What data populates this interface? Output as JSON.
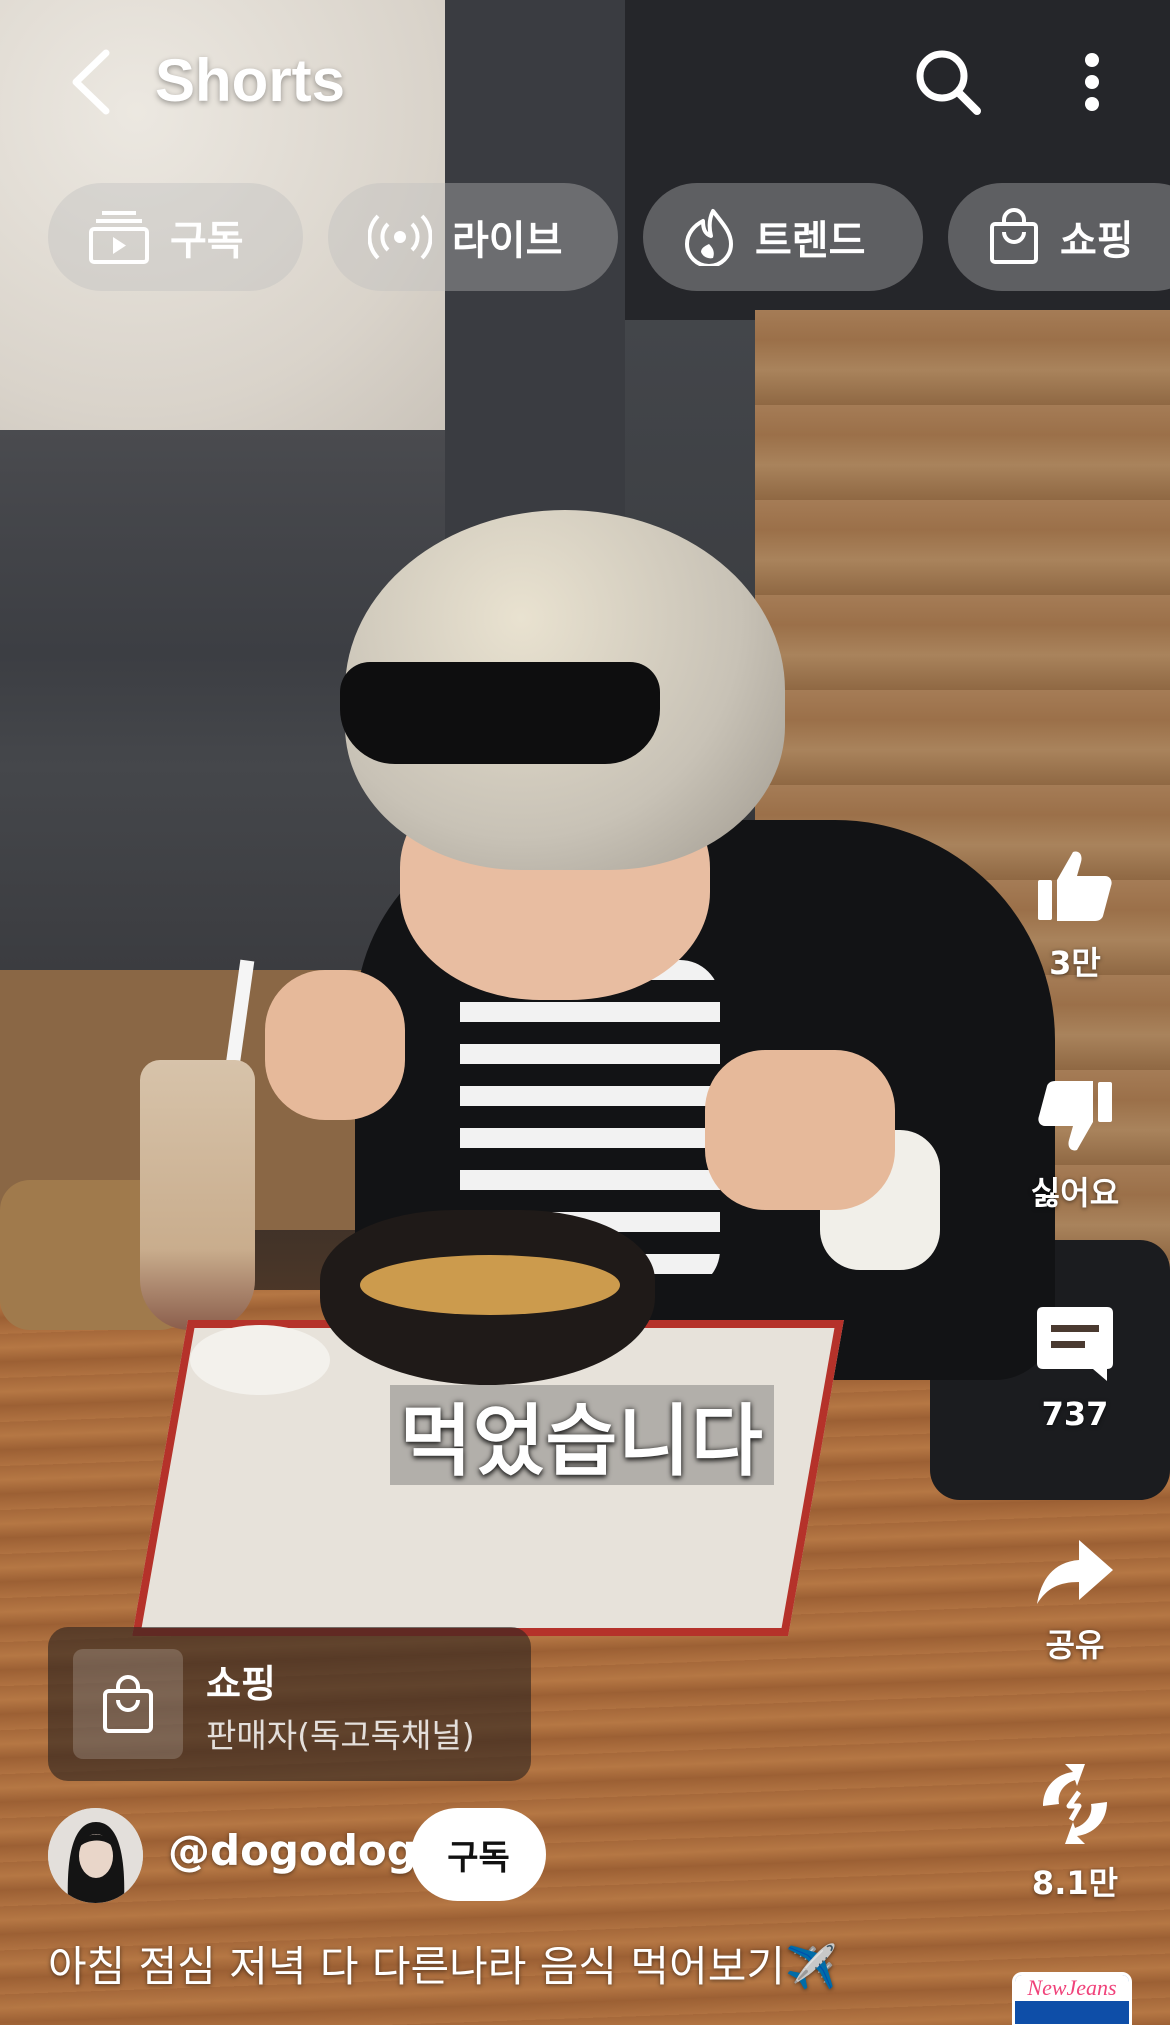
{
  "header": {
    "title": "Shorts"
  },
  "chips": [
    {
      "label": "구독",
      "icon": "subscriptions-icon"
    },
    {
      "label": "라이브",
      "icon": "live-broadcast-icon"
    },
    {
      "label": "트렌드",
      "icon": "trending-flame-icon"
    },
    {
      "label": "쇼핑",
      "icon": "shopping-bag-icon"
    }
  ],
  "video": {
    "caption": "먹었습니다"
  },
  "actions": {
    "like": "3만",
    "dislike": "싫어요",
    "comments": "737",
    "share": "공유",
    "remix": "8.1만"
  },
  "shopping": {
    "title": "쇼핑",
    "seller": "판매자(독고독채널)"
  },
  "channel": {
    "handle": "@dogodog",
    "subscribe_label": "구독"
  },
  "description": "아침 점심 저녁 다 다른나라 음식 먹어보기✈️",
  "music": {
    "thumb_text": "NewJeans"
  },
  "colors": {
    "subscribe_button_bg": "#ffffff",
    "chip_bg": "rgba(190,190,190,0.38)"
  }
}
